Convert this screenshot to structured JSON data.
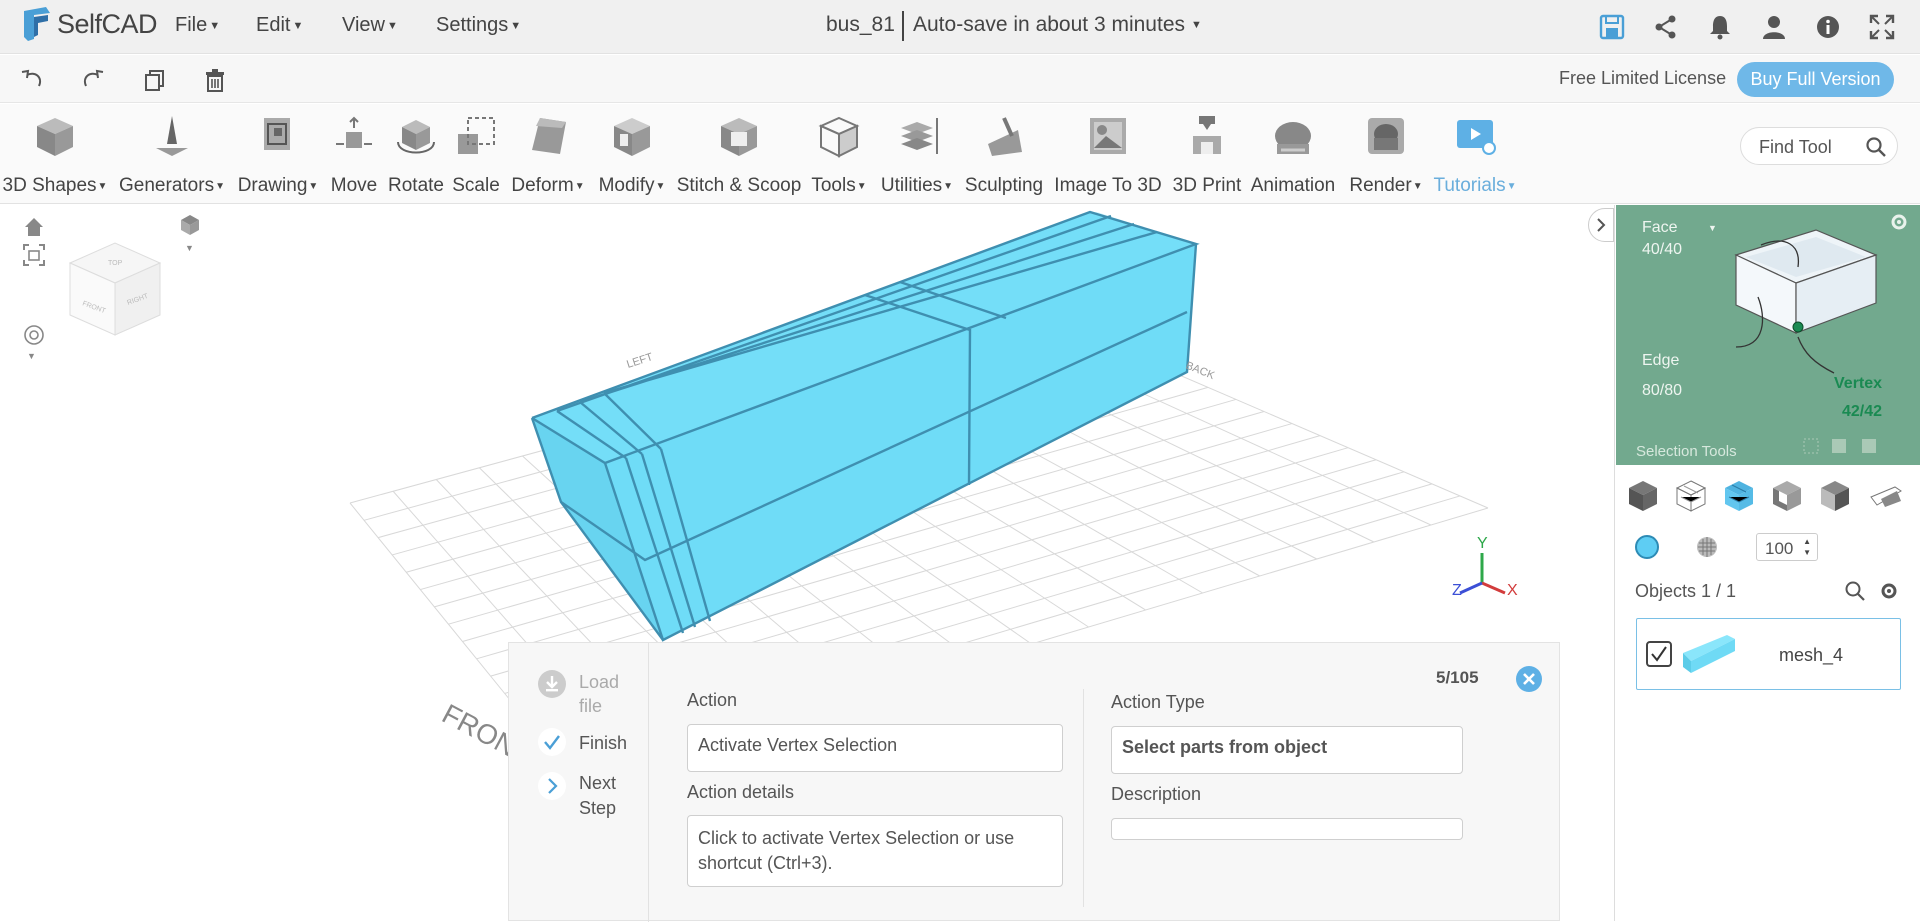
{
  "app": {
    "name": "SelfCAD"
  },
  "menu": [
    {
      "label": "File"
    },
    {
      "label": "Edit"
    },
    {
      "label": "View"
    },
    {
      "label": "Settings"
    }
  ],
  "document": {
    "title": "bus_81",
    "autosave": "Auto-save in about 3 minutes"
  },
  "license": {
    "text": "Free Limited License",
    "buy_label": "Buy Full Version"
  },
  "ribbon": [
    {
      "label": "3D Shapes",
      "icon": "cube-icon",
      "dropdown": true
    },
    {
      "label": "Generators",
      "icon": "generator-icon",
      "dropdown": true
    },
    {
      "label": "Drawing",
      "icon": "drawing-icon",
      "dropdown": true
    },
    {
      "label": "Move",
      "icon": "move-icon",
      "dropdown": false
    },
    {
      "label": "Rotate",
      "icon": "rotate-icon",
      "dropdown": false
    },
    {
      "label": "Scale",
      "icon": "scale-icon",
      "dropdown": false
    },
    {
      "label": "Deform",
      "icon": "deform-icon",
      "dropdown": true
    },
    {
      "label": "Modify",
      "icon": "modify-icon",
      "dropdown": true
    },
    {
      "label": "Stitch & Scoop",
      "icon": "stitch-icon",
      "dropdown": false
    },
    {
      "label": "Tools",
      "icon": "tools-icon",
      "dropdown": true
    },
    {
      "label": "Utilities",
      "icon": "utilities-icon",
      "dropdown": true
    },
    {
      "label": "Sculpting",
      "icon": "sculpting-icon",
      "dropdown": false
    },
    {
      "label": "Image To 3D",
      "icon": "image-to-3d-icon",
      "dropdown": false
    },
    {
      "label": "3D Print",
      "icon": "3d-print-icon",
      "dropdown": false
    },
    {
      "label": "Animation",
      "icon": "animation-icon",
      "dropdown": false
    },
    {
      "label": "Render",
      "icon": "render-icon",
      "dropdown": true
    },
    {
      "label": "Tutorials",
      "icon": "tutorials-icon",
      "dropdown": true
    }
  ],
  "find_tool": {
    "placeholder": "Find Tool"
  },
  "viewport": {
    "cube_faces": {
      "top": "TOP",
      "front": "FRONT",
      "right": "RIGHT"
    },
    "ground_labels": {
      "front": "FRONT",
      "left": "LEFT",
      "back": "BACK"
    },
    "axes": {
      "x": "X",
      "y": "Y",
      "z": "Z"
    },
    "colors": {
      "object": "#72e0fb",
      "edge": "#3f8fb0"
    }
  },
  "selection": {
    "face_label": "Face",
    "face_count": "40/40",
    "edge_label": "Edge",
    "edge_count": "80/80",
    "vertex_label": "Vertex",
    "vertex_count": "42/42",
    "section_label": "Selection Tools"
  },
  "opacity_value": "100",
  "objects": {
    "header": "Objects 1 / 1",
    "items": [
      {
        "name": "mesh_4",
        "checked": true
      }
    ]
  },
  "tutorial": {
    "progress": "5/105",
    "steps": [
      {
        "label": "Load file",
        "state": "disabled"
      },
      {
        "label": "Finish",
        "state": "done"
      },
      {
        "label": "Next Step",
        "state": "next"
      }
    ],
    "action_label": "Action",
    "action_value": "Activate Vertex Selection",
    "details_label": "Action details",
    "details_value": "Click to activate Vertex Selection or use shortcut (Ctrl+3).",
    "type_label": "Action Type",
    "type_value": "Select parts from object",
    "description_label": "Description",
    "description_value": ""
  }
}
